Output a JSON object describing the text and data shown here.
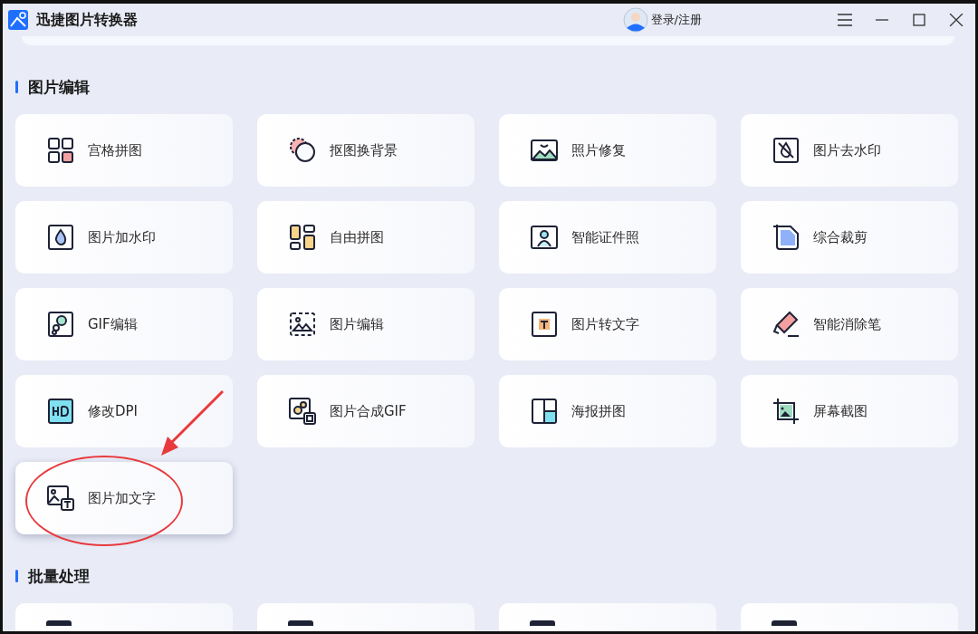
{
  "window": {
    "title": "迅捷图片转换器",
    "account": "登录/注册"
  },
  "sections": [
    {
      "title": "图片编辑",
      "tools": [
        {
          "label": "宫格拼图",
          "highlighted": false
        },
        {
          "label": "抠图换背景",
          "highlighted": false
        },
        {
          "label": "照片修复",
          "highlighted": false
        },
        {
          "label": "图片去水印",
          "highlighted": false
        },
        {
          "label": "图片加水印",
          "highlighted": false
        },
        {
          "label": "自由拼图",
          "highlighted": false
        },
        {
          "label": "智能证件照",
          "highlighted": false
        },
        {
          "label": "综合裁剪",
          "highlighted": false
        },
        {
          "label": "GIF编辑",
          "highlighted": false
        },
        {
          "label": "图片编辑",
          "highlighted": false
        },
        {
          "label": "图片转文字",
          "highlighted": false
        },
        {
          "label": "智能消除笔",
          "highlighted": false
        },
        {
          "label": "修改DPI",
          "highlighted": false
        },
        {
          "label": "图片合成GIF",
          "highlighted": false
        },
        {
          "label": "海报拼图",
          "highlighted": false
        },
        {
          "label": "屏幕截图",
          "highlighted": false
        },
        {
          "label": "图片加文字",
          "highlighted": true
        }
      ]
    },
    {
      "title": "批量处理",
      "tools": [
        {
          "highlighted": false
        },
        {
          "highlighted": false
        },
        {
          "highlighted": false
        },
        {
          "highlighted": false
        }
      ]
    }
  ]
}
